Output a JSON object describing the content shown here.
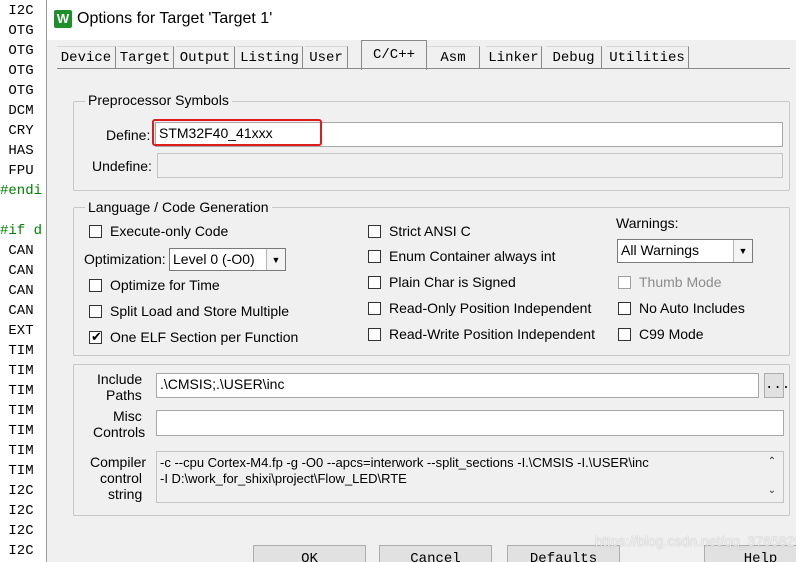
{
  "editor": {
    "lines": [
      {
        "text": " I2C",
        "pp": false
      },
      {
        "text": " OTG",
        "pp": false
      },
      {
        "text": " OTG",
        "pp": false
      },
      {
        "text": " OTG",
        "pp": false
      },
      {
        "text": " OTG",
        "pp": false
      },
      {
        "text": " DCM",
        "pp": false
      },
      {
        "text": " CRY",
        "pp": false
      },
      {
        "text": " HAS",
        "pp": false
      },
      {
        "text": " FPU",
        "pp": false
      },
      {
        "text": "#endi",
        "pp": true
      },
      {
        "text": "",
        "pp": false
      },
      {
        "text": "#if d",
        "pp": true
      },
      {
        "text": " CAN",
        "pp": false
      },
      {
        "text": " CAN",
        "pp": false
      },
      {
        "text": " CAN",
        "pp": false
      },
      {
        "text": " CAN",
        "pp": false
      },
      {
        "text": " EXT",
        "pp": false
      },
      {
        "text": " TIM",
        "pp": false
      },
      {
        "text": " TIM",
        "pp": false
      },
      {
        "text": " TIM",
        "pp": false
      },
      {
        "text": " TIM",
        "pp": false
      },
      {
        "text": " TIM",
        "pp": false
      },
      {
        "text": " TIM",
        "pp": false
      },
      {
        "text": " TIM",
        "pp": false
      },
      {
        "text": " I2C",
        "pp": false
      },
      {
        "text": " I2C",
        "pp": false
      },
      {
        "text": " I2C",
        "pp": false
      },
      {
        "text": " I2C",
        "pp": false
      }
    ]
  },
  "dialog": {
    "title": "Options for Target 'Target 1'",
    "icon_text": "W",
    "tabs": [
      "Device",
      "Target",
      "Output",
      "Listing",
      "User",
      "C/C++",
      "Asm",
      "Linker",
      "Debug",
      "Utilities"
    ],
    "active_tab": "C/C++",
    "preprocessor": {
      "group_title": "Preprocessor Symbols",
      "define_label": "Define:",
      "define_value": "STM32F40_41xxx",
      "undefine_label": "Undefine:",
      "undefine_value": ""
    },
    "language": {
      "group_title": "Language / Code Generation",
      "execute_only": {
        "label": "Execute-only Code",
        "checked": false
      },
      "optimization_label": "Optimization:",
      "optimization_value": "Level 0 (-O0)",
      "optimize_time": {
        "label": "Optimize for Time",
        "checked": false
      },
      "split_load": {
        "label": "Split Load and Store Multiple",
        "checked": false
      },
      "one_elf": {
        "label": "One ELF Section per Function",
        "checked": true
      },
      "strict_ansi": {
        "label": "Strict ANSI C",
        "checked": false
      },
      "enum_container": {
        "label": "Enum Container always int",
        "checked": false
      },
      "plain_char": {
        "label": "Plain Char is Signed",
        "checked": false
      },
      "ro_position": {
        "label": "Read-Only Position Independent",
        "checked": false
      },
      "rw_position": {
        "label": "Read-Write Position Independent",
        "checked": false
      },
      "warnings_label": "Warnings:",
      "warnings_value": "All Warnings",
      "thumb_mode": {
        "label": "Thumb Mode",
        "checked": false,
        "disabled": true
      },
      "no_auto_includes": {
        "label": "No Auto Includes",
        "checked": false
      },
      "c99_mode": {
        "label": "C99 Mode",
        "checked": false
      }
    },
    "include_paths": {
      "label_line1": "Include",
      "label_line2": "Paths",
      "value": ".\\CMSIS;.\\USER\\inc",
      "browse_label": "..."
    },
    "misc_controls": {
      "label_line1": "Misc",
      "label_line2": "Controls",
      "value": ""
    },
    "compiler_control": {
      "label_line1": "Compiler",
      "label_line2": "control",
      "label_line3": "string",
      "line1": "-c --cpu Cortex-M4.fp -g -O0 --apcs=interwork --split_sections -I.\\CMSIS -I.\\USER\\inc",
      "line2": "-I D:\\work_for_shixi\\project\\Flow_LED\\RTE"
    },
    "buttons": {
      "ok": "OK",
      "cancel": "Cancel",
      "defaults": "Defaults",
      "help": "Help"
    }
  },
  "watermark": "https://blog.csdn.net/qq_37658298",
  "colors": {
    "highlight": "#e11b1b",
    "dialog_bg": "#f0f0f0",
    "preprocessor_green": "#008000"
  }
}
